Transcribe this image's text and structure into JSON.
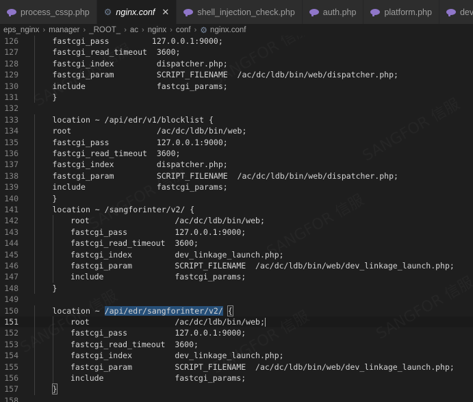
{
  "tabs": [
    {
      "label": "process_cssp.php",
      "icon": "php-icon",
      "active": false
    },
    {
      "label": "nginx.conf",
      "icon": "gear-icon",
      "active": true
    },
    {
      "label": "shell_injection_check.php",
      "icon": "php-icon",
      "active": false
    },
    {
      "label": "auth.php",
      "icon": "php-icon",
      "active": false
    },
    {
      "label": "platform.php",
      "icon": "php-icon",
      "active": false
    },
    {
      "label": "dev_link",
      "icon": "php-icon",
      "active": false
    }
  ],
  "tab_close_glyph": "✕",
  "breadcrumb": [
    "eps_nginx",
    "manager",
    "_ROOT_",
    "ac",
    "nginx",
    "conf",
    "nginx.conf"
  ],
  "editor": {
    "lines": [
      {
        "n": "126",
        "indent": 2,
        "text": "fastcgi_pass         127.0.0.1:9000;"
      },
      {
        "n": "127",
        "indent": 2,
        "text": "fastcgi_read_timeout  3600;"
      },
      {
        "n": "128",
        "indent": 2,
        "text": "fastcgi_index         dispatcher.php;"
      },
      {
        "n": "129",
        "indent": 2,
        "text": "fastcgi_param         SCRIPT_FILENAME  /ac/dc/ldb/bin/web/dispatcher.php;"
      },
      {
        "n": "130",
        "indent": 2,
        "text": "include               fastcgi_params;"
      },
      {
        "n": "131",
        "indent": 2,
        "text": "}"
      },
      {
        "n": "132",
        "indent": 0,
        "text": ""
      },
      {
        "n": "133",
        "indent": 2,
        "text": "location ~ /api/edr/v1/blocklist {"
      },
      {
        "n": "134",
        "indent": 2,
        "text": "root                  /ac/dc/ldb/bin/web;"
      },
      {
        "n": "135",
        "indent": 2,
        "text": "fastcgi_pass          127.0.0.1:9000;"
      },
      {
        "n": "136",
        "indent": 2,
        "text": "fastcgi_read_timeout  3600;"
      },
      {
        "n": "137",
        "indent": 2,
        "text": "fastcgi_index         dispatcher.php;"
      },
      {
        "n": "138",
        "indent": 2,
        "text": "fastcgi_param         SCRIPT_FILENAME  /ac/dc/ldb/bin/web/dispatcher.php;"
      },
      {
        "n": "139",
        "indent": 2,
        "text": "include               fastcgi_params;"
      },
      {
        "n": "140",
        "indent": 2,
        "text": "}"
      },
      {
        "n": "141",
        "indent": 2,
        "text": "location ~ /sangforinter/v2/ {"
      },
      {
        "n": "142",
        "indent": 3,
        "text": "root                  /ac/dc/ldb/bin/web;"
      },
      {
        "n": "143",
        "indent": 3,
        "text": "fastcgi_pass          127.0.0.1:9000;"
      },
      {
        "n": "144",
        "indent": 3,
        "text": "fastcgi_read_timeout  3600;"
      },
      {
        "n": "145",
        "indent": 3,
        "text": "fastcgi_index         dev_linkage_launch.php;"
      },
      {
        "n": "146",
        "indent": 3,
        "text": "fastcgi_param         SCRIPT_FILENAME  /ac/dc/ldb/bin/web/dev_linkage_launch.php;"
      },
      {
        "n": "147",
        "indent": 3,
        "text": "include               fastcgi_params;"
      },
      {
        "n": "148",
        "indent": 2,
        "text": "}"
      },
      {
        "n": "149",
        "indent": 0,
        "text": ""
      },
      {
        "n": "150",
        "indent": 2,
        "text": "location ~ /api/edr/sangforinter/v2/ {"
      },
      {
        "n": "151",
        "indent": 3,
        "text": "root                  /ac/dc/ldb/bin/web;"
      },
      {
        "n": "152",
        "indent": 3,
        "text": "fastcgi_pass          127.0.0.1:9000;"
      },
      {
        "n": "153",
        "indent": 3,
        "text": "fastcgi_read_timeout  3600;"
      },
      {
        "n": "154",
        "indent": 3,
        "text": "fastcgi_index         dev_linkage_launch.php;"
      },
      {
        "n": "155",
        "indent": 3,
        "text": "fastcgi_param         SCRIPT_FILENAME  /ac/dc/ldb/bin/web/dev_linkage_launch.php;"
      },
      {
        "n": "156",
        "indent": 3,
        "text": "include               fastcgi_params;"
      },
      {
        "n": "157",
        "indent": 2,
        "text": "}"
      },
      {
        "n": "158",
        "indent": 0,
        "text": ""
      }
    ],
    "selection_text": "/api/edr/sangforinter/v2/",
    "colors": {
      "background": "#1e1e1e",
      "text": "#d4d4d4",
      "line_number": "#858585",
      "selection": "#264f78"
    }
  }
}
